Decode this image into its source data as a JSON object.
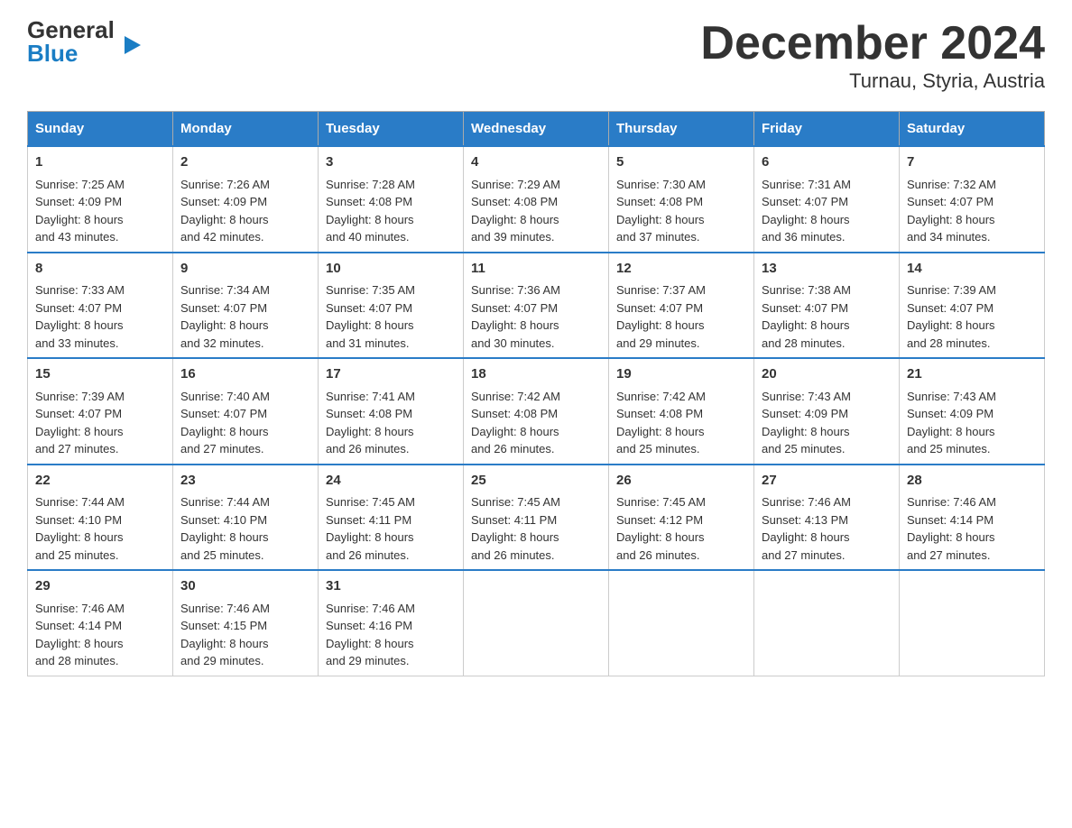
{
  "header": {
    "logo": {
      "line1": "General",
      "triangle_symbol": "▶",
      "line2": "Blue"
    },
    "title": "December 2024",
    "subtitle": "Turnau, Styria, Austria"
  },
  "days_of_week": [
    "Sunday",
    "Monday",
    "Tuesday",
    "Wednesday",
    "Thursday",
    "Friday",
    "Saturday"
  ],
  "weeks": [
    [
      {
        "day": "1",
        "sunrise": "7:25 AM",
        "sunset": "4:09 PM",
        "daylight_hours": "8 hours",
        "daylight_min": "and 43 minutes."
      },
      {
        "day": "2",
        "sunrise": "7:26 AM",
        "sunset": "4:09 PM",
        "daylight_hours": "8 hours",
        "daylight_min": "and 42 minutes."
      },
      {
        "day": "3",
        "sunrise": "7:28 AM",
        "sunset": "4:08 PM",
        "daylight_hours": "8 hours",
        "daylight_min": "and 40 minutes."
      },
      {
        "day": "4",
        "sunrise": "7:29 AM",
        "sunset": "4:08 PM",
        "daylight_hours": "8 hours",
        "daylight_min": "and 39 minutes."
      },
      {
        "day": "5",
        "sunrise": "7:30 AM",
        "sunset": "4:08 PM",
        "daylight_hours": "8 hours",
        "daylight_min": "and 37 minutes."
      },
      {
        "day": "6",
        "sunrise": "7:31 AM",
        "sunset": "4:07 PM",
        "daylight_hours": "8 hours",
        "daylight_min": "and 36 minutes."
      },
      {
        "day": "7",
        "sunrise": "7:32 AM",
        "sunset": "4:07 PM",
        "daylight_hours": "8 hours",
        "daylight_min": "and 34 minutes."
      }
    ],
    [
      {
        "day": "8",
        "sunrise": "7:33 AM",
        "sunset": "4:07 PM",
        "daylight_hours": "8 hours",
        "daylight_min": "and 33 minutes."
      },
      {
        "day": "9",
        "sunrise": "7:34 AM",
        "sunset": "4:07 PM",
        "daylight_hours": "8 hours",
        "daylight_min": "and 32 minutes."
      },
      {
        "day": "10",
        "sunrise": "7:35 AM",
        "sunset": "4:07 PM",
        "daylight_hours": "8 hours",
        "daylight_min": "and 31 minutes."
      },
      {
        "day": "11",
        "sunrise": "7:36 AM",
        "sunset": "4:07 PM",
        "daylight_hours": "8 hours",
        "daylight_min": "and 30 minutes."
      },
      {
        "day": "12",
        "sunrise": "7:37 AM",
        "sunset": "4:07 PM",
        "daylight_hours": "8 hours",
        "daylight_min": "and 29 minutes."
      },
      {
        "day": "13",
        "sunrise": "7:38 AM",
        "sunset": "4:07 PM",
        "daylight_hours": "8 hours",
        "daylight_min": "and 28 minutes."
      },
      {
        "day": "14",
        "sunrise": "7:39 AM",
        "sunset": "4:07 PM",
        "daylight_hours": "8 hours",
        "daylight_min": "and 28 minutes."
      }
    ],
    [
      {
        "day": "15",
        "sunrise": "7:39 AM",
        "sunset": "4:07 PM",
        "daylight_hours": "8 hours",
        "daylight_min": "and 27 minutes."
      },
      {
        "day": "16",
        "sunrise": "7:40 AM",
        "sunset": "4:07 PM",
        "daylight_hours": "8 hours",
        "daylight_min": "and 27 minutes."
      },
      {
        "day": "17",
        "sunrise": "7:41 AM",
        "sunset": "4:08 PM",
        "daylight_hours": "8 hours",
        "daylight_min": "and 26 minutes."
      },
      {
        "day": "18",
        "sunrise": "7:42 AM",
        "sunset": "4:08 PM",
        "daylight_hours": "8 hours",
        "daylight_min": "and 26 minutes."
      },
      {
        "day": "19",
        "sunrise": "7:42 AM",
        "sunset": "4:08 PM",
        "daylight_hours": "8 hours",
        "daylight_min": "and 25 minutes."
      },
      {
        "day": "20",
        "sunrise": "7:43 AM",
        "sunset": "4:09 PM",
        "daylight_hours": "8 hours",
        "daylight_min": "and 25 minutes."
      },
      {
        "day": "21",
        "sunrise": "7:43 AM",
        "sunset": "4:09 PM",
        "daylight_hours": "8 hours",
        "daylight_min": "and 25 minutes."
      }
    ],
    [
      {
        "day": "22",
        "sunrise": "7:44 AM",
        "sunset": "4:10 PM",
        "daylight_hours": "8 hours",
        "daylight_min": "and 25 minutes."
      },
      {
        "day": "23",
        "sunrise": "7:44 AM",
        "sunset": "4:10 PM",
        "daylight_hours": "8 hours",
        "daylight_min": "and 25 minutes."
      },
      {
        "day": "24",
        "sunrise": "7:45 AM",
        "sunset": "4:11 PM",
        "daylight_hours": "8 hours",
        "daylight_min": "and 26 minutes."
      },
      {
        "day": "25",
        "sunrise": "7:45 AM",
        "sunset": "4:11 PM",
        "daylight_hours": "8 hours",
        "daylight_min": "and 26 minutes."
      },
      {
        "day": "26",
        "sunrise": "7:45 AM",
        "sunset": "4:12 PM",
        "daylight_hours": "8 hours",
        "daylight_min": "and 26 minutes."
      },
      {
        "day": "27",
        "sunrise": "7:46 AM",
        "sunset": "4:13 PM",
        "daylight_hours": "8 hours",
        "daylight_min": "and 27 minutes."
      },
      {
        "day": "28",
        "sunrise": "7:46 AM",
        "sunset": "4:14 PM",
        "daylight_hours": "8 hours",
        "daylight_min": "and 27 minutes."
      }
    ],
    [
      {
        "day": "29",
        "sunrise": "7:46 AM",
        "sunset": "4:14 PM",
        "daylight_hours": "8 hours",
        "daylight_min": "and 28 minutes."
      },
      {
        "day": "30",
        "sunrise": "7:46 AM",
        "sunset": "4:15 PM",
        "daylight_hours": "8 hours",
        "daylight_min": "and 29 minutes."
      },
      {
        "day": "31",
        "sunrise": "7:46 AM",
        "sunset": "4:16 PM",
        "daylight_hours": "8 hours",
        "daylight_min": "and 29 minutes."
      },
      null,
      null,
      null,
      null
    ]
  ],
  "labels": {
    "sunrise": "Sunrise:",
    "sunset": "Sunset:",
    "daylight": "Daylight:"
  }
}
